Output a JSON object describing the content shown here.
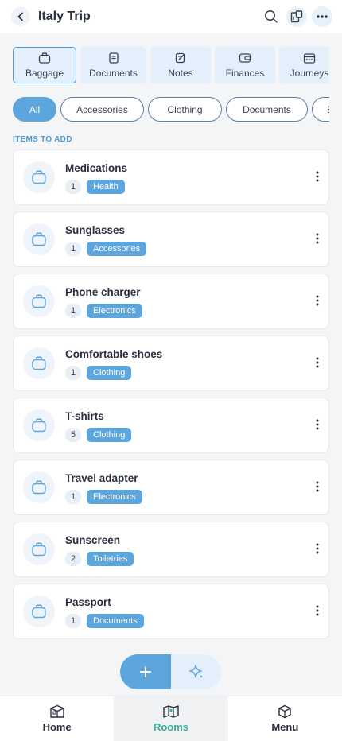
{
  "header": {
    "title": "Italy Trip",
    "back_icon": "chevron-left-icon",
    "search_icon": "search-icon",
    "rooms_icon": "layout-icon",
    "more_icon": "more-horizontal-icon"
  },
  "tabs": [
    {
      "label": "Baggage",
      "icon": "bag-icon",
      "active": true
    },
    {
      "label": "Documents",
      "icon": "document-icon"
    },
    {
      "label": "Notes",
      "icon": "note-icon"
    },
    {
      "label": "Finances",
      "icon": "wallet-icon"
    },
    {
      "label": "Journeys",
      "icon": "calendar-icon"
    }
  ],
  "filters": [
    {
      "label": "All",
      "active": true
    },
    {
      "label": "Accessories"
    },
    {
      "label": "Clothing"
    },
    {
      "label": "Documents"
    },
    {
      "label": "El"
    }
  ],
  "section_label": "ITEMS TO ADD",
  "items": [
    {
      "title": "Medications",
      "qty": "1",
      "category": "Health"
    },
    {
      "title": "Sunglasses",
      "qty": "1",
      "category": "Accessories"
    },
    {
      "title": "Phone charger",
      "qty": "1",
      "category": "Electronics"
    },
    {
      "title": "Comfortable shoes",
      "qty": "1",
      "category": "Clothing"
    },
    {
      "title": "T-shirts",
      "qty": "5",
      "category": "Clothing"
    },
    {
      "title": "Travel adapter",
      "qty": "1",
      "category": "Electronics"
    },
    {
      "title": "Sunscreen",
      "qty": "2",
      "category": "Toiletries"
    },
    {
      "title": "Passport",
      "qty": "1",
      "category": "Documents"
    }
  ],
  "fab": {
    "add_icon": "plus-icon",
    "ai_icon": "sparkle-icon"
  },
  "bottom_nav": [
    {
      "label": "Home",
      "icon": "home-icon"
    },
    {
      "label": "Rooms",
      "icon": "rooms-icon",
      "active": true
    },
    {
      "label": "Menu",
      "icon": "menu-icon"
    }
  ],
  "colors": {
    "accent": "#5da5dd",
    "accent_light": "#e3f0fb",
    "nav_active": "#3aae9c"
  }
}
